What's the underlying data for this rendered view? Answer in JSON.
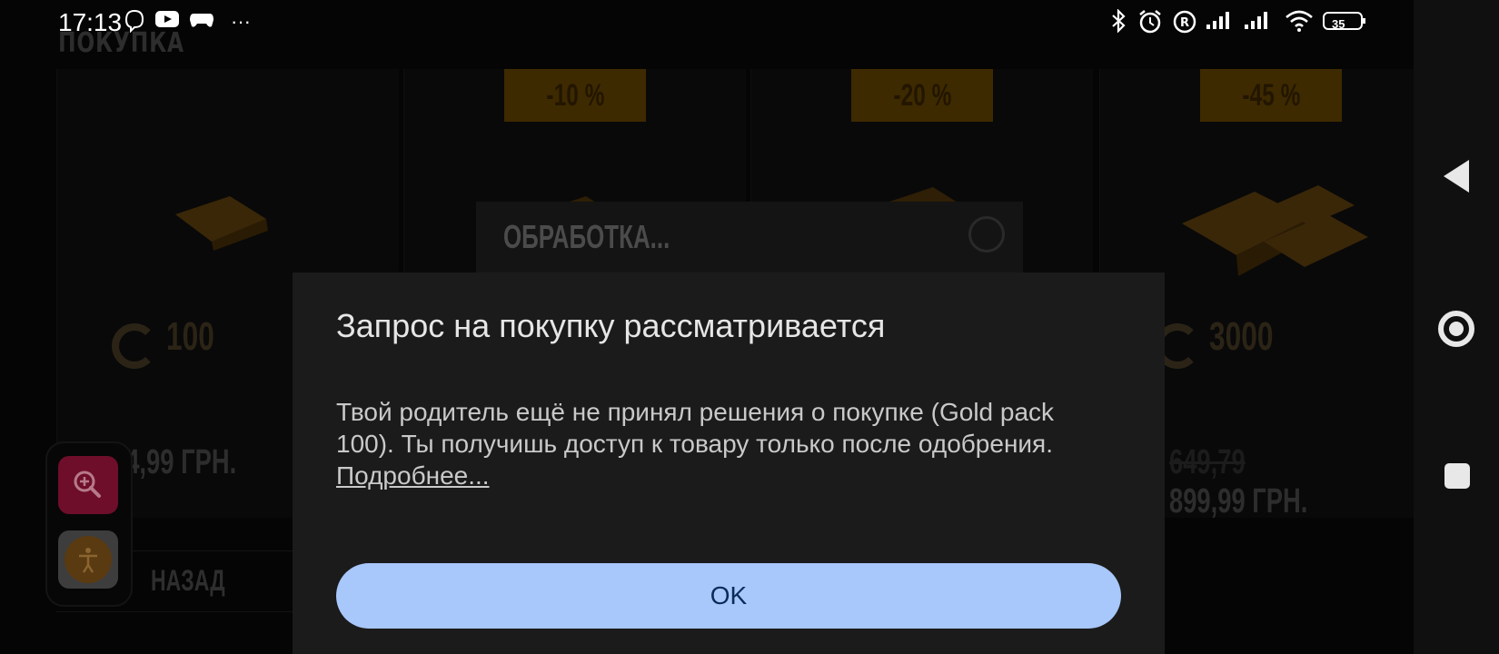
{
  "status_bar": {
    "time": "17:13",
    "battery": "35",
    "left_icons": [
      "viber-icon",
      "youtube-icon",
      "game-controller-icon",
      "more-dots-icon"
    ],
    "right_icons": [
      "bluetooth-icon",
      "alarm-icon",
      "roaming-icon",
      "signal-icon",
      "signal-icon",
      "wifi-icon",
      "battery-icon"
    ]
  },
  "game": {
    "title": "ПОКУПКА",
    "cards": [
      {
        "badge": "",
        "amount": "100",
        "price": "54,99 ГРН.",
        "old_price": ""
      },
      {
        "badge": "-10 %",
        "amount": "",
        "price": "",
        "old_price": ""
      },
      {
        "badge": "-20 %",
        "amount": "",
        "price": "",
        "old_price": ""
      },
      {
        "badge": "-45 %",
        "amount": "3000",
        "price": "899,99 ГРН.",
        "old_price": "649,79"
      }
    ],
    "back_label": "НАЗАД",
    "processing_label": "ОБРАБОТКА..."
  },
  "dialog": {
    "title": "Запрос на покупку рассматривается",
    "body": "Твой родитель ещё не принял решения о покупке (Gold pack 100). Ты получишь доступ к товару только после одобрения.",
    "link": "Подробнее...",
    "ok_label": "OK"
  },
  "colors": {
    "dialog_bg": "#1b1b1b",
    "ok_button": "#a8c7fa",
    "zoom_button": "#6e0e2b"
  }
}
